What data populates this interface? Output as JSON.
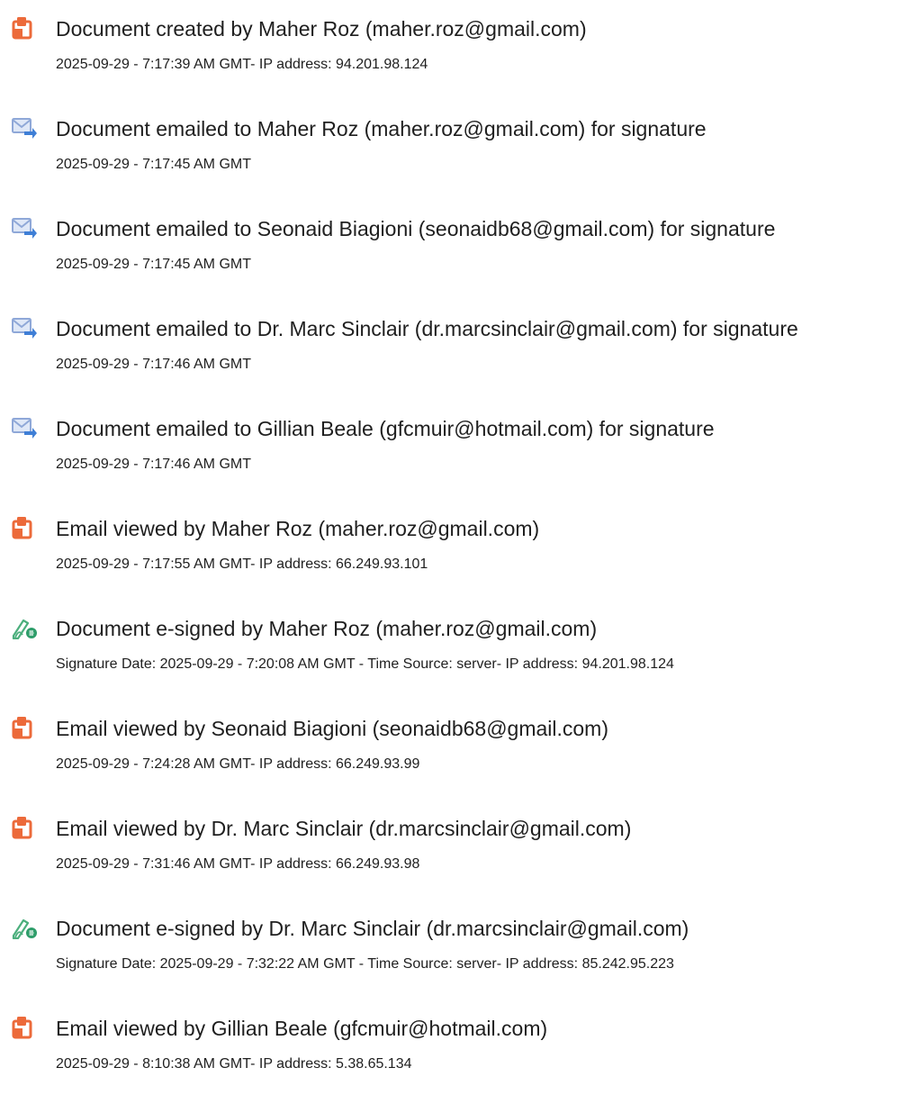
{
  "colors": {
    "pdf_icon": "#ec6a3a",
    "email_icon_envelope": "#8fa8d8",
    "email_icon_arrow": "#3f7fd6",
    "esign_icon_pen": "#4caf7d",
    "esign_icon_badge": "#2e9d6a"
  },
  "events": [
    {
      "icon": "document-created-icon",
      "title": "Document created by Maher Roz (maher.roz@gmail.com)",
      "detail": "2025-09-29 - 7:17:39 AM GMT- IP address: 94.201.98.124"
    },
    {
      "icon": "email-sent-icon",
      "title": "Document emailed to Maher Roz (maher.roz@gmail.com) for signature",
      "detail": "2025-09-29 - 7:17:45 AM GMT"
    },
    {
      "icon": "email-sent-icon",
      "title": "Document emailed to Seonaid Biagioni (seonaidb68@gmail.com) for signature",
      "detail": "2025-09-29 - 7:17:45 AM GMT"
    },
    {
      "icon": "email-sent-icon",
      "title": "Document emailed to Dr. Marc Sinclair (dr.marcsinclair@gmail.com) for signature",
      "detail": "2025-09-29 - 7:17:46 AM GMT"
    },
    {
      "icon": "email-sent-icon",
      "title": "Document emailed to Gillian Beale (gfcmuir@hotmail.com) for signature",
      "detail": "2025-09-29 - 7:17:46 AM GMT"
    },
    {
      "icon": "document-viewed-icon",
      "title": "Email viewed by Maher Roz (maher.roz@gmail.com)",
      "detail": "2025-09-29 - 7:17:55 AM GMT- IP address: 66.249.93.101"
    },
    {
      "icon": "e-sign-icon",
      "title": "Document e-signed by Maher Roz (maher.roz@gmail.com)",
      "detail": "Signature Date: 2025-09-29 - 7:20:08 AM GMT - Time Source: server- IP address: 94.201.98.124"
    },
    {
      "icon": "document-viewed-icon",
      "title": "Email viewed by Seonaid Biagioni (seonaidb68@gmail.com)",
      "detail": "2025-09-29 - 7:24:28 AM GMT- IP address: 66.249.93.99"
    },
    {
      "icon": "document-viewed-icon",
      "title": "Email viewed by Dr. Marc Sinclair (dr.marcsinclair@gmail.com)",
      "detail": "2025-09-29 - 7:31:46 AM GMT- IP address: 66.249.93.98"
    },
    {
      "icon": "e-sign-icon",
      "title": "Document e-signed by Dr. Marc Sinclair (dr.marcsinclair@gmail.com)",
      "detail": "Signature Date: 2025-09-29 - 7:32:22 AM GMT - Time Source: server- IP address: 85.242.95.223"
    },
    {
      "icon": "document-viewed-icon",
      "title": "Email viewed by Gillian Beale (gfcmuir@hotmail.com)",
      "detail": "2025-09-29 - 8:10:38 AM GMT- IP address: 5.38.65.134"
    }
  ]
}
